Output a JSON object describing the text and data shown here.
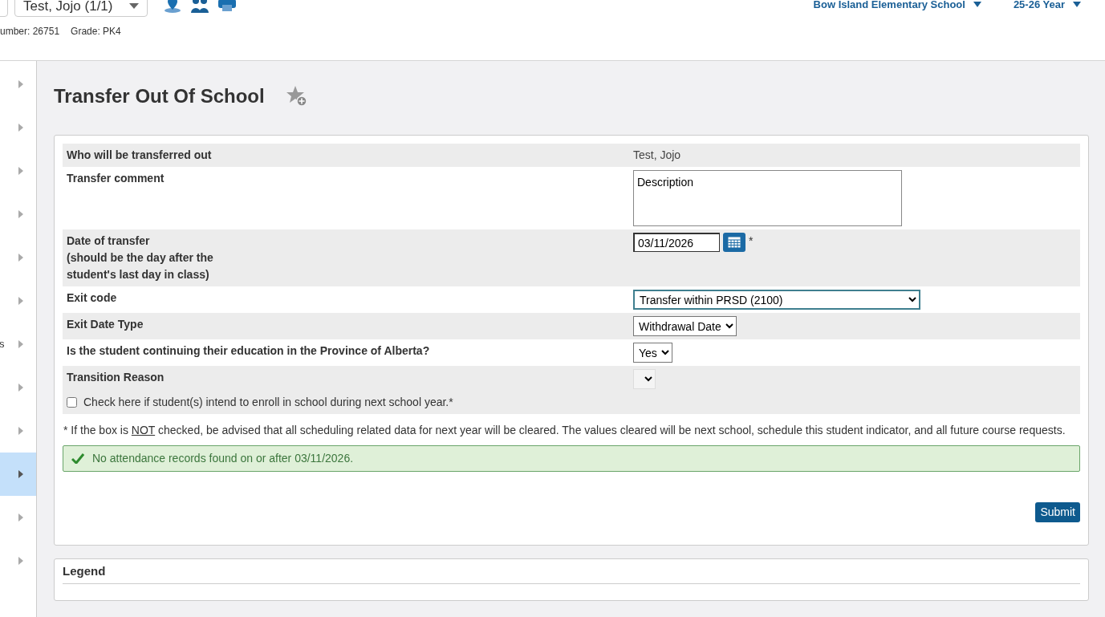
{
  "header": {
    "student_selector": "Test, Jojo  (1/1)",
    "student_number": "umber: 26751",
    "grade": "Grade: PK4",
    "school": "Bow Island Elementary School",
    "year": "25-26 Year"
  },
  "sidebar": {
    "items": [
      {
        "selected": false
      },
      {
        "selected": false
      },
      {
        "selected": false
      },
      {
        "selected": false
      },
      {
        "selected": false
      },
      {
        "selected": false
      },
      {
        "selected": false,
        "label": "s"
      },
      {
        "selected": false
      },
      {
        "selected": false
      },
      {
        "selected": true
      },
      {
        "selected": false
      },
      {
        "selected": false
      }
    ]
  },
  "page_title": "Transfer Out Of School",
  "form": {
    "rows": [
      {
        "kind": "text",
        "label": [
          "Who will be transferred out"
        ],
        "value": "Test, Jojo"
      },
      {
        "kind": "textarea",
        "label": [
          "Transfer comment"
        ],
        "value": "Description"
      },
      {
        "kind": "date",
        "label": [
          "Date of transfer",
          "(should be the day after the",
          "student's last day in class)"
        ],
        "value": "03/11/2026",
        "required": "*"
      },
      {
        "kind": "longselect",
        "label": [
          "Exit code"
        ],
        "value": "Transfer within PRSD (2100)"
      },
      {
        "kind": "select",
        "label": [
          "Exit Date Type"
        ],
        "value": "Withdrawal Date"
      },
      {
        "kind": "select",
        "label": [
          "Is the student continuing their education in the Province of Alberta?"
        ],
        "value": "Yes"
      },
      {
        "kind": "select",
        "label": [
          "Transition Reason"
        ],
        "disabled": true
      },
      {
        "kind": "checkbox",
        "label": [
          "Check here if student(s) intend to enroll in school during next school year.*"
        ],
        "checked": false
      }
    ],
    "note": [
      {
        "text": "* If the box is "
      },
      {
        "text": "NOT",
        "underline": true
      },
      {
        "text": " checked, be advised that all scheduling related data for next year will be cleared. The values cleared will be next school, schedule this student indicator, and all future course requests."
      }
    ],
    "alert": {
      "kind": "success",
      "text": "No attendance records found on or after 03/11/2026."
    },
    "submit": "Submit"
  },
  "legend": {
    "title": "Legend"
  }
}
